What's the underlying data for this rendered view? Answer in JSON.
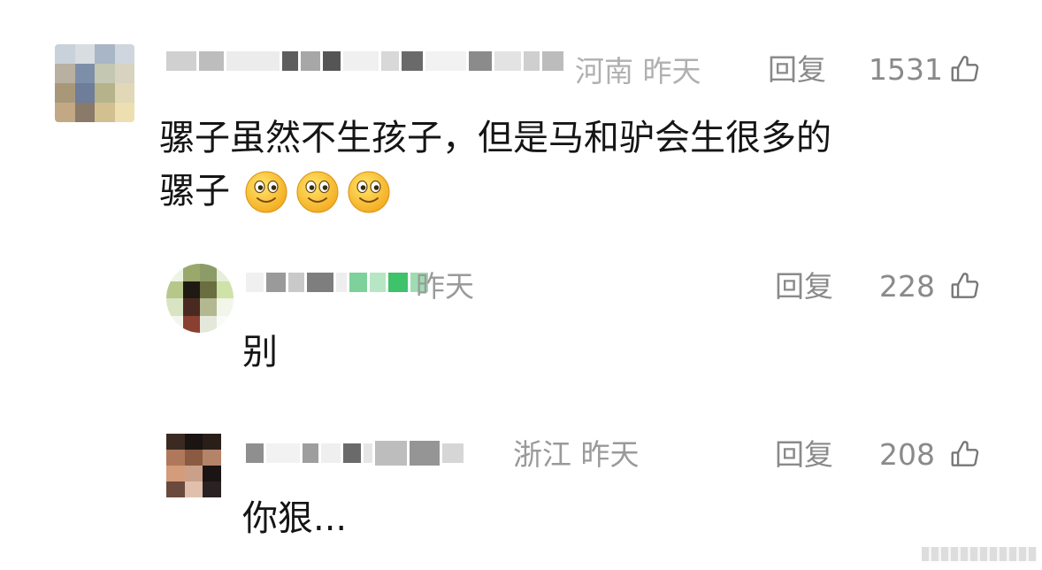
{
  "comments": [
    {
      "location_time": "河南 昨天",
      "reply_label": "回复",
      "likes": "1531",
      "text_line1": "骡子虽然不生孩子，但是马和驴会生很多的",
      "text_line2": "骡子",
      "emoji": [
        "smile-emoji",
        "smile-emoji",
        "smile-emoji"
      ]
    },
    {
      "location_time": "昨天",
      "reply_label": "回复",
      "likes": "228",
      "text": "别"
    },
    {
      "location_time": "浙江 昨天",
      "reply_label": "回复",
      "likes": "208",
      "text": "你狠..."
    }
  ],
  "icons": {
    "like": "thumbs-up-icon",
    "emoji": "smile-emoji"
  },
  "colors": {
    "meta_gray": "#9a9a9a",
    "text": "#151515",
    "background": "#ffffff"
  }
}
